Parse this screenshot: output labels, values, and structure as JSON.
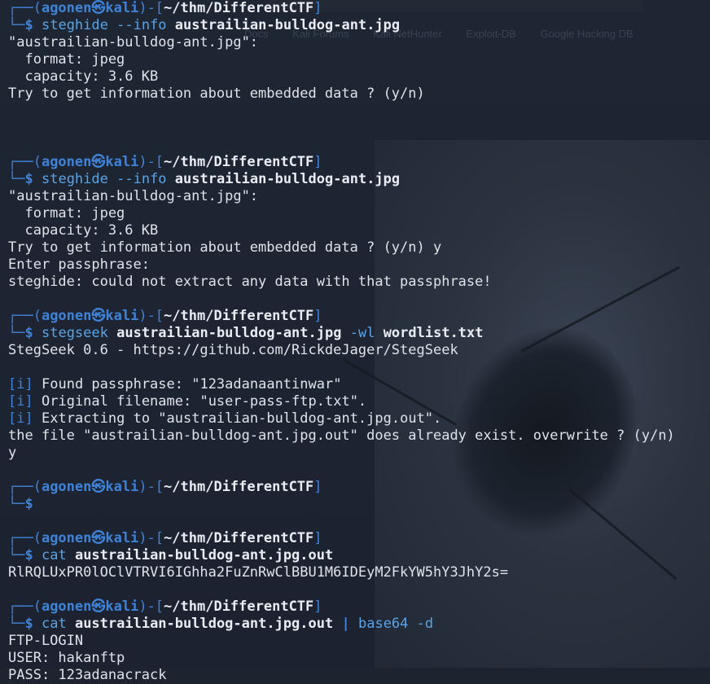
{
  "background_faded": {
    "bookmarks": [
      "Docs",
      "Kali Forums",
      "Kali NetHunter",
      "Exploit-DB",
      "Google Hacking DB"
    ]
  },
  "prompt": {
    "user": "agonen",
    "host": "kali",
    "path": "~/thm/DifferentCTF",
    "symbol": "$"
  },
  "blocks": [
    {
      "command": {
        "program": "steghide",
        "flag": "--info",
        "arg": "austrailian-bulldog-ant.jpg"
      },
      "output": [
        "\"austrailian-bulldog-ant.jpg\":",
        "  format: jpeg",
        "  capacity: 3.6 KB",
        "Try to get information about embedded data ? (y/n)"
      ],
      "trailing_blank": 2
    },
    {
      "command": {
        "program": "steghide",
        "flag": "--info",
        "arg": "austrailian-bulldog-ant.jpg"
      },
      "output": [
        "\"austrailian-bulldog-ant.jpg\":",
        "  format: jpeg",
        "  capacity: 3.6 KB",
        "Try to get information about embedded data ? (y/n) y",
        "Enter passphrase:",
        "steghide: could not extract any data with that passphrase!"
      ],
      "trailing_blank": 1
    },
    {
      "command": {
        "program": "stegseek",
        "arg": "austrailian-bulldog-ant.jpg",
        "flag": "-wl",
        "arg2": "wordlist.txt"
      },
      "output_intro": "StegSeek 0.6 - https://github.com/RickdeJager/StegSeek",
      "info_lines": [
        "Found passphrase: \"123adanaantinwar\"",
        "Original filename: \"user-pass-ftp.txt\".",
        "Extracting to \"austrailian-bulldog-ant.jpg.out\"."
      ],
      "output": [
        "the file \"austrailian-bulldog-ant.jpg.out\" does already exist. overwrite ? (y/n)",
        "y"
      ],
      "info_marker": "i"
    },
    {
      "command": null
    },
    {
      "command": {
        "program": "cat",
        "arg": "austrailian-bulldog-ant.jpg.out"
      },
      "output": [
        "RlRQLUxPR0lOClVTRVI6IGhha2FuZnRwClBBU1M6IDEyM2FkYW5hY3JhY2s="
      ]
    },
    {
      "command": {
        "program": "cat",
        "arg": "austrailian-bulldog-ant.jpg.out",
        "pipe": "|",
        "program2": "base64",
        "flag": "-d"
      },
      "output": [
        "FTP-LOGIN",
        "USER: hakanftp",
        "PASS: 123adanacrack"
      ]
    }
  ]
}
